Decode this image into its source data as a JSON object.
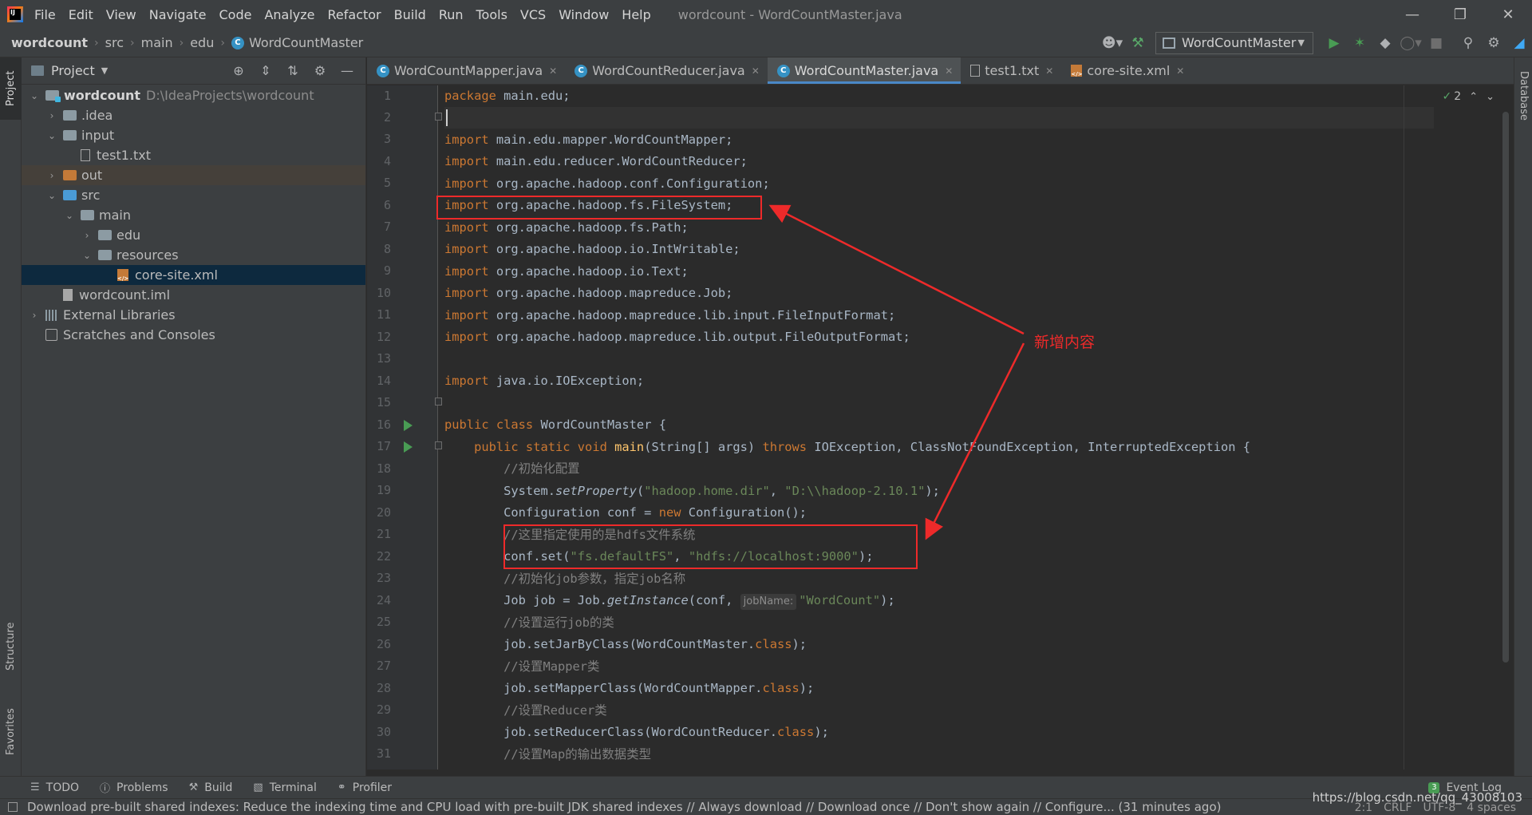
{
  "window": {
    "title": "wordcount - WordCountMaster.java",
    "menu": [
      "File",
      "Edit",
      "View",
      "Navigate",
      "Code",
      "Analyze",
      "Refactor",
      "Build",
      "Run",
      "Tools",
      "VCS",
      "Window",
      "Help"
    ]
  },
  "breadcrumb": [
    "wordcount",
    "src",
    "main",
    "edu",
    "WordCountMaster"
  ],
  "toolbar": {
    "run_config": "WordCountMaster"
  },
  "left_stripe": {
    "project": "Project",
    "structure": "Structure",
    "favorites": "Favorites"
  },
  "right_stripe": {
    "database": "Database"
  },
  "project_panel": {
    "title": "Project",
    "tree": [
      {
        "label": "wordcount",
        "path": "D:\\IdeaProjects\\wordcount"
      },
      {
        "label": ".idea"
      },
      {
        "label": "input"
      },
      {
        "label": "test1.txt"
      },
      {
        "label": "out"
      },
      {
        "label": "src"
      },
      {
        "label": "main"
      },
      {
        "label": "edu"
      },
      {
        "label": "resources"
      },
      {
        "label": "core-site.xml"
      },
      {
        "label": "wordcount.iml"
      },
      {
        "label": "External Libraries"
      },
      {
        "label": "Scratches and Consoles"
      }
    ]
  },
  "tabs": [
    "WordCountMapper.java",
    "WordCountReducer.java",
    "WordCountMaster.java",
    "test1.txt",
    "core-site.xml"
  ],
  "inspection": {
    "count": "2"
  },
  "line_numbers": [
    "1",
    "2",
    "3",
    "4",
    "5",
    "6",
    "7",
    "8",
    "9",
    "10",
    "11",
    "12",
    "13",
    "14",
    "15",
    "16",
    "17",
    "18",
    "19",
    "20",
    "21",
    "22",
    "23",
    "24",
    "25",
    "26",
    "27",
    "28",
    "29",
    "30",
    "31"
  ],
  "code": {
    "l1": {
      "a": "package",
      "b": " main.edu;"
    },
    "l3": {
      "a": "import",
      "b": " main.edu.mapper.WordCountMapper;"
    },
    "l4": {
      "a": "import",
      "b": " main.edu.reducer.WordCountReducer;"
    },
    "l5": {
      "a": "import",
      "b": " org.apache.hadoop.conf.Configuration;"
    },
    "l6": {
      "a": "import",
      "b": " org.apache.hadoop.fs.FileSystem;"
    },
    "l7": {
      "a": "import",
      "b": " org.apache.hadoop.fs.Path;"
    },
    "l8": {
      "a": "import",
      "b": " org.apache.hadoop.io.IntWritable;"
    },
    "l9": {
      "a": "import",
      "b": " org.apache.hadoop.io.Text;"
    },
    "l10": {
      "a": "import",
      "b": " org.apache.hadoop.mapreduce.Job;"
    },
    "l11": {
      "a": "import",
      "b": " org.apache.hadoop.mapreduce.lib.input.FileInputFormat;"
    },
    "l12": {
      "a": "import",
      "b": " org.apache.hadoop.mapreduce.lib.output.FileOutputFormat;"
    },
    "l14": {
      "a": "import",
      "b": " java.io.IOException;"
    },
    "l16": {
      "a": "public class",
      "b": " WordCountMaster {"
    },
    "l17": {
      "a": "    public static void",
      "fn": " main",
      "b": "(String[] args) ",
      "c": "throws",
      "d": " IOException, ClassNotFoundException, InterruptedException {"
    },
    "l18": {
      "cm": "        //初始化配置"
    },
    "l19": {
      "a": "        System.",
      "it": "setProperty",
      "b": "(",
      "s1": "\"hadoop.home.dir\"",
      "c": ", ",
      "s2": "\"D:\\\\hadoop-2.10.1\"",
      "d": ");"
    },
    "l20": {
      "a": "        Configuration conf = ",
      "kw": "new",
      "b": " Configuration();"
    },
    "l21": {
      "cm": "        //这里指定使用的是hdfs文件系统"
    },
    "l22": {
      "a": "        conf.set(",
      "s1": "\"fs.defaultFS\"",
      "b": ", ",
      "s2": "\"hdfs://localhost:9000\"",
      "c": ");"
    },
    "l23": {
      "cm": "        //初始化job参数，指定job名称"
    },
    "l24": {
      "a": "        Job job = Job.",
      "it": "getInstance",
      "b": "(conf, ",
      "hint": "jobName:",
      "s1": "\"WordCount\"",
      "c": ");"
    },
    "l25": {
      "cm": "        //设置运行job的类"
    },
    "l26": {
      "a": "        job.setJarByClass(WordCountMaster.",
      "kw": "class",
      "b": ");"
    },
    "l27": {
      "cm": "        //设置Mapper类"
    },
    "l28": {
      "a": "        job.setMapperClass(WordCountMapper.",
      "kw": "class",
      "b": ");"
    },
    "l29": {
      "cm": "        //设置Reducer类"
    },
    "l30": {
      "a": "        job.setReducerClass(WordCountReducer.",
      "kw": "class",
      "b": ");"
    },
    "l31": {
      "cm": "        //设置Map的输出数据类型"
    }
  },
  "annotation": {
    "label": "新增内容",
    "color": "#ee2a2a"
  },
  "bottom_tools": [
    "TODO",
    "Problems",
    "Build",
    "Terminal",
    "Profiler"
  ],
  "event_log": {
    "count": "3",
    "label": "Event Log"
  },
  "status": {
    "message": "Download pre-built shared indexes: Reduce the indexing time and CPU load with pre-built JDK shared indexes // Always download // Download once // Don't show again // Configure... (31 minutes ago)",
    "position": "2:1",
    "line_sep": "CRLF",
    "encoding": "UTF-8",
    "indent": "4 spaces"
  },
  "watermark": "https://blog.csdn.net/qq_43008103",
  "colors": {
    "keyword": "#cc7832",
    "string": "#6a8759",
    "comment": "#808080",
    "function": "#ffc66d",
    "text": "#a9b7c6",
    "accent": "#4a88c7"
  }
}
